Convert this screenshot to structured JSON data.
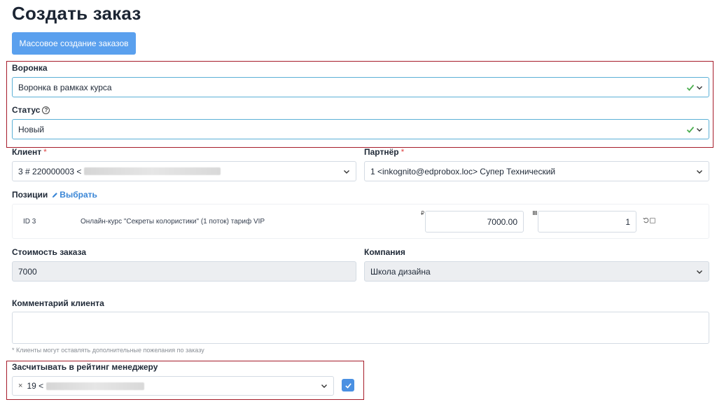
{
  "page": {
    "title": "Создать заказ"
  },
  "mass_button": {
    "label": "Массовое создание заказов"
  },
  "funnel": {
    "label": "Воронка",
    "value": "Воронка в рамках курса"
  },
  "status": {
    "label": "Статус",
    "value": "Новый"
  },
  "client": {
    "label": "Клиент",
    "required_mark": "*",
    "value": "3 # 220000003 <"
  },
  "partner": {
    "label": "Партнёр",
    "required_mark": "*",
    "value": "1 <inkognito@edprobox.loc> Супер Технический"
  },
  "positions": {
    "label": "Позиции",
    "choose_label": "Выбрать",
    "items": [
      {
        "id": "ID 3",
        "name": "Онлайн-курс \"Секреты колористики\" (1 поток) тариф VIP",
        "currency": "₽",
        "price": "7000.00",
        "quantity": "1"
      }
    ]
  },
  "order_cost": {
    "label": "Стоимость заказа",
    "value": "7000"
  },
  "company": {
    "label": "Компания",
    "value": "Школа дизайна"
  },
  "comment": {
    "label": "Комментарий клиента",
    "value": "",
    "hint": "* Клиенты могут оставлять дополнительные пожелания по заказу"
  },
  "rating": {
    "label": "Засчитывать в рейтинг менеджеру",
    "remove_glyph": "×",
    "manager_value": "19 <",
    "checkbox_checked": true
  },
  "icons": {
    "valid": "check-icon",
    "dropdown": "chevron-down-icon",
    "help": "help-circle-icon",
    "edit": "pencil-icon",
    "quantity": "quantity-icon",
    "reset": "reset-icon"
  },
  "colors": {
    "accent": "#5aa0ee",
    "valid": "#4caf50",
    "required": "#e04b4b",
    "highlight": "#a61c2a",
    "link": "#3a86d6"
  }
}
